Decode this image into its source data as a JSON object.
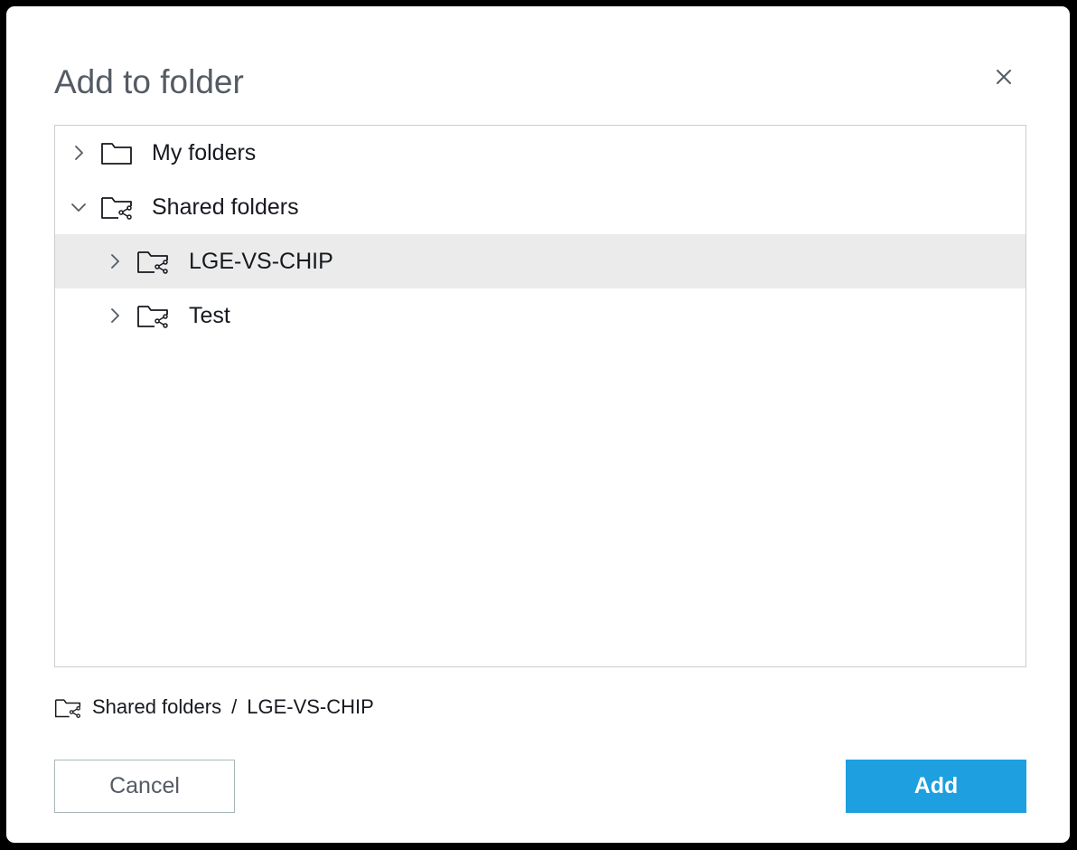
{
  "dialog": {
    "title": "Add to folder",
    "close_icon": "close-icon"
  },
  "tree": {
    "rows": [
      {
        "label": "My folders",
        "expanded": false,
        "icon": "folder-icon",
        "level": 0,
        "selected": false
      },
      {
        "label": "Shared folders",
        "expanded": true,
        "icon": "shared-folder-icon",
        "level": 0,
        "selected": false
      },
      {
        "label": "LGE-VS-CHIP",
        "expanded": false,
        "icon": "shared-folder-icon",
        "level": 1,
        "selected": true
      },
      {
        "label": "Test",
        "expanded": false,
        "icon": "shared-folder-icon",
        "level": 1,
        "selected": false
      }
    ]
  },
  "path": {
    "icon": "shared-folder-icon",
    "segments": [
      "Shared folders",
      "LGE-VS-CHIP"
    ],
    "separator": "/"
  },
  "footer": {
    "cancel_label": "Cancel",
    "add_label": "Add"
  },
  "colors": {
    "title": "#545b64",
    "selected_row": "#ebebeb",
    "primary_button": "#1d9fe0",
    "text": "#16191f"
  }
}
